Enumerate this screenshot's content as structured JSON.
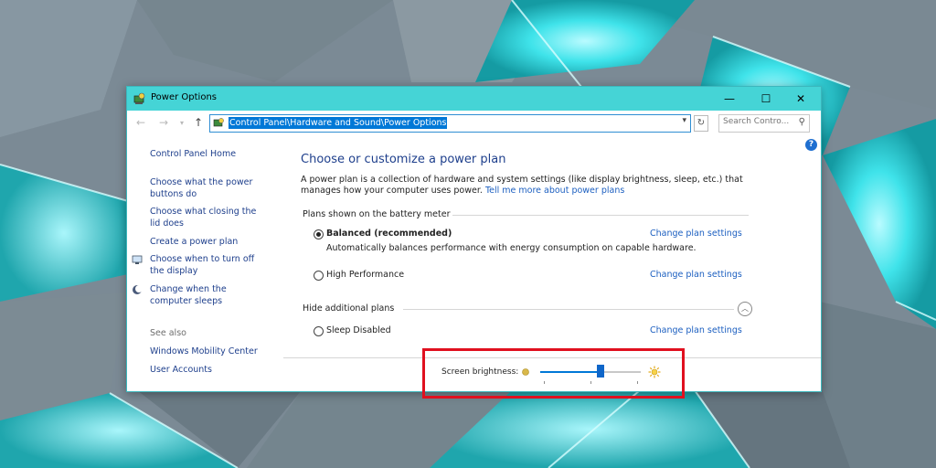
{
  "window": {
    "title": "Power Options",
    "controls": {
      "minimize": "—",
      "maximize": "☐",
      "close": "✕"
    }
  },
  "addressbar": {
    "path": "Control Panel\\Hardware and Sound\\Power Options",
    "search_placeholder": "Search Contro...",
    "icons": {
      "back": "arrow-left-icon",
      "forward": "arrow-right-icon",
      "recent": "chevron-down-icon",
      "up": "arrow-up-icon",
      "refresh": "refresh-icon",
      "search": "search-icon"
    }
  },
  "sidebar": {
    "home": "Control Panel Home",
    "items": [
      {
        "label": "Choose what the power buttons do"
      },
      {
        "label": "Choose what closing the lid does"
      },
      {
        "label": "Create a power plan"
      },
      {
        "label": "Choose when to turn off the display",
        "icon": "display-icon"
      },
      {
        "label": "Change when the computer sleeps",
        "icon": "moon-icon"
      }
    ],
    "see_also_heading": "See also",
    "see_also": [
      {
        "label": "Windows Mobility Center"
      },
      {
        "label": "User Accounts"
      }
    ]
  },
  "main": {
    "heading": "Choose or customize a power plan",
    "description": "A power plan is a collection of hardware and system settings (like display brightness, sleep, etc.) that manages how your computer uses power.",
    "tell_me_link": "Tell me more about power plans",
    "group_battery": "Plans shown on the battery meter",
    "group_additional": "Hide additional plans",
    "change_label": "Change plan settings",
    "plans": [
      {
        "name": "Balanced (recommended)",
        "desc": "Automatically balances performance with energy consumption on capable hardware.",
        "selected": true
      },
      {
        "name": "High Performance",
        "desc": "",
        "selected": false
      },
      {
        "name": "Sleep Disabled",
        "desc": "",
        "selected": false
      }
    ]
  },
  "brightness": {
    "label": "Screen brightness:",
    "level_percent": 60
  },
  "colors": {
    "titlebar": "#45d4d6",
    "link": "#1c5fc0",
    "heading": "#1e3f8c",
    "highlight": "#e0101f",
    "selection": "#0078d7"
  }
}
